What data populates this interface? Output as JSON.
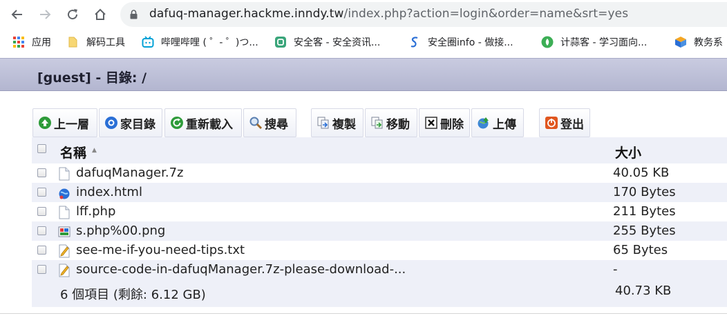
{
  "browser": {
    "url_host": "dafuq-manager.hackme.inndy.tw",
    "url_path": "/index.php?action=login&order=name&srt=yes"
  },
  "bookmarks": [
    {
      "label": "应用",
      "icon": "apps-grid-icon"
    },
    {
      "label": "解码工具",
      "icon": "folder-icon"
    },
    {
      "label": "哔哩哔哩 ( ゜- ゜)つ...",
      "icon": "bilibili-icon"
    },
    {
      "label": "安全客 - 安全资讯...",
      "icon": "anquanke-icon"
    },
    {
      "label": "安全圈info - 做接...",
      "icon": "anquanquan-icon"
    },
    {
      "label": "计蒜客 - 学习面向...",
      "icon": "jisuanke-icon"
    },
    {
      "label": "教务系",
      "icon": "cube-icon"
    }
  ],
  "fm": {
    "title": "[guest] - 目錄: /",
    "toolbar": {
      "up": "上一層",
      "home": "家目錄",
      "reload": "重新載入",
      "search": "搜尋",
      "copy": "複製",
      "move": "移動",
      "delete": "刪除",
      "upload": "上傳",
      "logout": "登出"
    },
    "columns": {
      "name": "名稱",
      "sort_indicator": "▲",
      "size": "大小"
    },
    "files": [
      {
        "name": "dafuqManager.7z",
        "size": "40.05 KB",
        "icon": "file-icon"
      },
      {
        "name": "index.html",
        "size": "170 Bytes",
        "icon": "html-file-icon"
      },
      {
        "name": "lff.php",
        "size": "211 Bytes",
        "icon": "file-icon"
      },
      {
        "name": "s.php%00.png",
        "size": "255 Bytes",
        "icon": "image-file-icon"
      },
      {
        "name": "see-me-if-you-need-tips.txt",
        "size": "65 Bytes",
        "icon": "text-file-icon"
      },
      {
        "name": "source-code-in-dafuqManager.7z-please-download-...",
        "size": "-",
        "icon": "text-file-icon"
      }
    ],
    "summary": {
      "items": "6 個項目 (剩餘: 6.12 GB)",
      "total": "40.73 KB"
    }
  },
  "colors": {
    "header_bg": "#b9bcd4",
    "row_alt": "#eef0f8",
    "accent_green": "#2e9b3a",
    "accent_blue": "#2a6fd6"
  }
}
